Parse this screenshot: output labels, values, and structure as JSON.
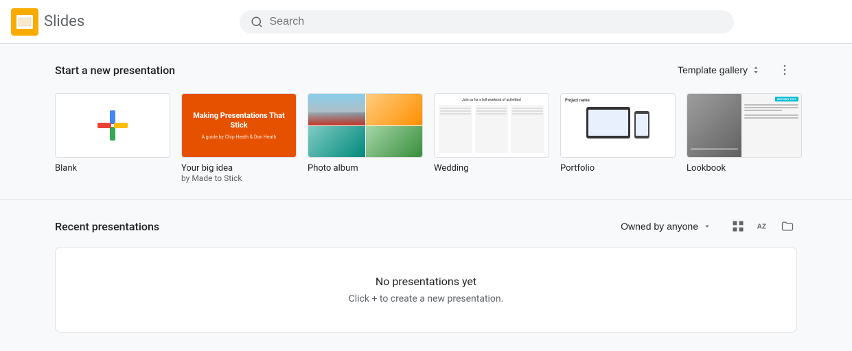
{
  "app": {
    "name": "Slides",
    "logo_color": "#F9AB00"
  },
  "header": {
    "search_placeholder": "Search"
  },
  "templates_section": {
    "title": "Start a new presentation",
    "gallery_button": "Template gallery",
    "more_button": "⋮",
    "templates": [
      {
        "id": "blank",
        "label": "Blank",
        "sublabel": "",
        "type": "blank"
      },
      {
        "id": "big-idea",
        "label": "Your big idea",
        "sublabel": "by Made to Stick",
        "type": "big-idea",
        "title_text": "Making Presentations That Stick",
        "sub_text": "A guide by Chip Heath & Dan Heath"
      },
      {
        "id": "photo-album",
        "label": "Photo album",
        "sublabel": "",
        "type": "photo-album"
      },
      {
        "id": "wedding",
        "label": "Wedding",
        "sublabel": "",
        "type": "wedding",
        "header_text": "Join us for a full weekend of activities!"
      },
      {
        "id": "portfolio",
        "label": "Portfolio",
        "sublabel": "",
        "type": "portfolio",
        "header_text": "Project name"
      },
      {
        "id": "lookbook",
        "label": "Lookbook",
        "sublabel": "",
        "type": "lookbook",
        "tag_text": "WRITER'S TEXT"
      }
    ]
  },
  "recent_section": {
    "title": "Recent presentations",
    "owned_by_label": "Owned by anyone",
    "empty_title": "No presentations yet",
    "empty_sub": "Click + to create a new presentation."
  }
}
